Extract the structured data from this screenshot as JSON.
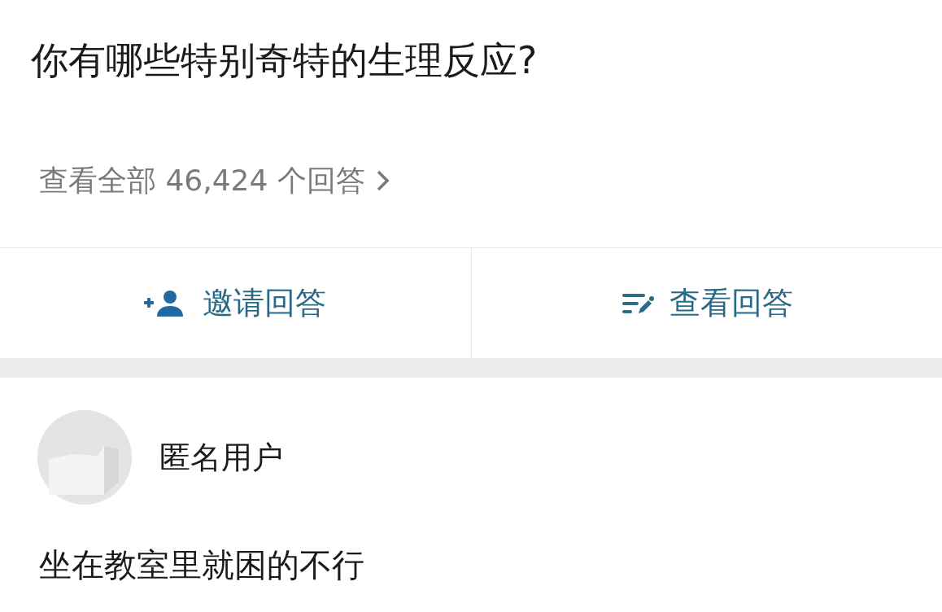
{
  "question": {
    "title": "你有哪些特别奇特的生理反应?",
    "view_all": "查看全部 46,424 个回答"
  },
  "actions": [
    {
      "kind": "invite",
      "label": "邀请回答"
    },
    {
      "kind": "view",
      "label": "查看回答"
    }
  ],
  "answer": {
    "author": "匿名用户",
    "text": "坐在教室里就困的不行"
  }
}
